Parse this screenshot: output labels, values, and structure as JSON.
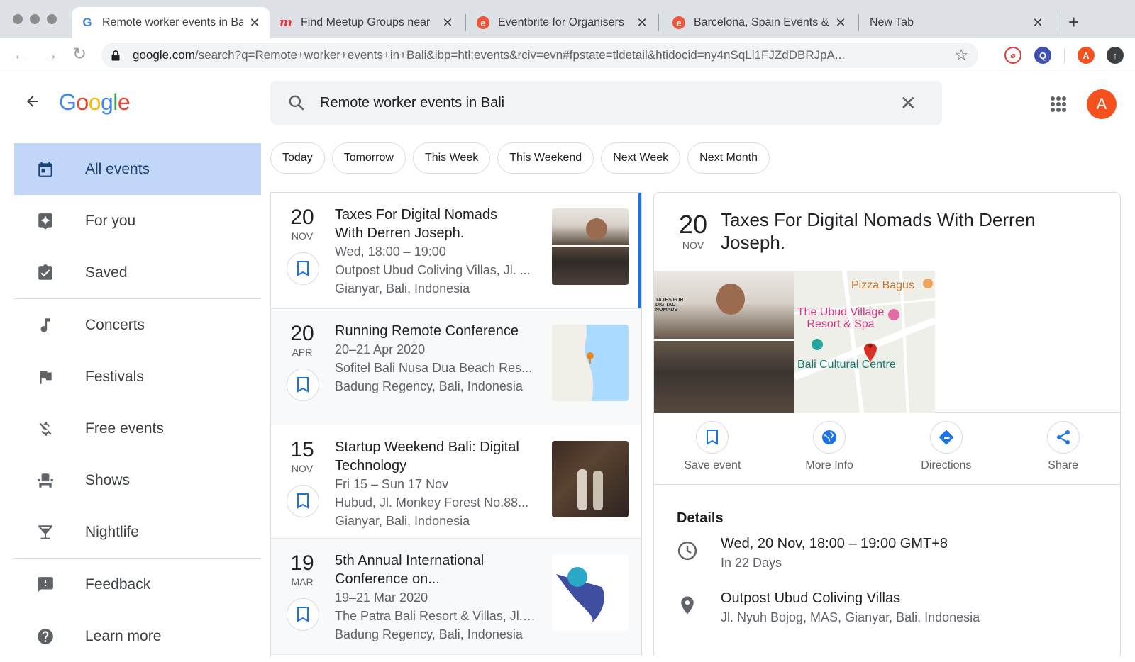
{
  "browser": {
    "tabs": [
      {
        "title": "Remote worker events in Bali",
        "favicon": "google-g-icon"
      },
      {
        "title": "Find Meetup Groups near",
        "favicon": "meetup-icon"
      },
      {
        "title": "Eventbrite for Organisers",
        "favicon": "eventbrite-icon"
      },
      {
        "title": "Barcelona, Spain Events &",
        "favicon": "eventbrite-icon"
      },
      {
        "title": "New Tab",
        "favicon": ""
      }
    ],
    "url_host": "google.com",
    "url_path": "/search?q=Remote+worker+events+in+Bali&ibp=htl;events&rciv=evn#fpstate=tldetail&htidocid=ny4nSqLl1FJZdDBRJpA...",
    "profile_initial": "A"
  },
  "header": {
    "logo": "Google",
    "search_query": "Remote worker events in Bali",
    "avatar_initial": "A"
  },
  "chips": [
    "Today",
    "Tomorrow",
    "This Week",
    "This Weekend",
    "Next Week",
    "Next Month"
  ],
  "sidebar": {
    "items": [
      {
        "label": "All events",
        "icon": "calendar-icon"
      },
      {
        "label": "For you",
        "icon": "sparkle-icon"
      },
      {
        "label": "Saved",
        "icon": "clipboard-check-icon"
      },
      {
        "label": "Concerts",
        "icon": "music-note-icon"
      },
      {
        "label": "Festivals",
        "icon": "flag-icon"
      },
      {
        "label": "Free events",
        "icon": "money-off-icon"
      },
      {
        "label": "Shows",
        "icon": "theater-seat-icon"
      },
      {
        "label": "Nightlife",
        "icon": "cocktail-icon"
      },
      {
        "label": "Feedback",
        "icon": "feedback-icon"
      },
      {
        "label": "Learn more",
        "icon": "help-icon"
      }
    ]
  },
  "events": [
    {
      "day": "20",
      "month": "NOV",
      "title_lines": [
        "Taxes For Digital Nomads",
        "With Derren Joseph."
      ],
      "lines": [
        "Wed, 18:00 – 19:00",
        "Outpost Ubud Coliving Villas, Jl. ...",
        "Gianyar, Bali, Indonesia"
      ]
    },
    {
      "day": "20",
      "month": "APR",
      "title_lines": [
        "Running Remote Conference"
      ],
      "lines": [
        "20–21 Apr 2020",
        "Sofitel Bali Nusa Dua Beach Res...",
        "Badung Regency, Bali, Indonesia"
      ]
    },
    {
      "day": "15",
      "month": "NOV",
      "title_lines": [
        "Startup Weekend Bali: Digital",
        "Technology"
      ],
      "lines": [
        "Fri 15 – Sun 17 Nov",
        "Hubud, Jl. Monkey Forest No.88...",
        "Gianyar, Bali, Indonesia"
      ]
    },
    {
      "day": "19",
      "month": "MAR",
      "title_lines": [
        "5th Annual International",
        "Conference on..."
      ],
      "lines": [
        "19–21 Mar 2020",
        "The Patra Bali Resort & Villas, Jl.I...",
        "Badung Regency, Bali, Indonesia"
      ]
    }
  ],
  "detail": {
    "day": "20",
    "month": "NOV",
    "title": "Taxes For Digital Nomads With Derren Joseph.",
    "map_labels": {
      "pizza": "Pizza Bagus",
      "resort": "The Ubud Village Resort & Spa",
      "centre": "Bali Cultural Centre"
    },
    "poster_text": "TAXES FOR DIGITAL NOMADS",
    "actions": [
      {
        "label": "Save event",
        "icon": "bookmark-icon"
      },
      {
        "label": "More Info",
        "icon": "globe-icon"
      },
      {
        "label": "Directions",
        "icon": "directions-icon"
      },
      {
        "label": "Share",
        "icon": "share-icon"
      }
    ],
    "details_heading": "Details",
    "when": {
      "line1": "Wed, 20 Nov, 18:00 – 19:00 GMT+8",
      "line2": "In 22 Days"
    },
    "where": {
      "line1": "Outpost Ubud Coliving Villas",
      "line2": "Jl. Nyuh Bojog, MAS, Gianyar, Bali, Indonesia"
    }
  },
  "colors": {
    "accent": "#1a73e8",
    "active_nav": "#c2d7f7",
    "avatar": "#f4511e"
  }
}
